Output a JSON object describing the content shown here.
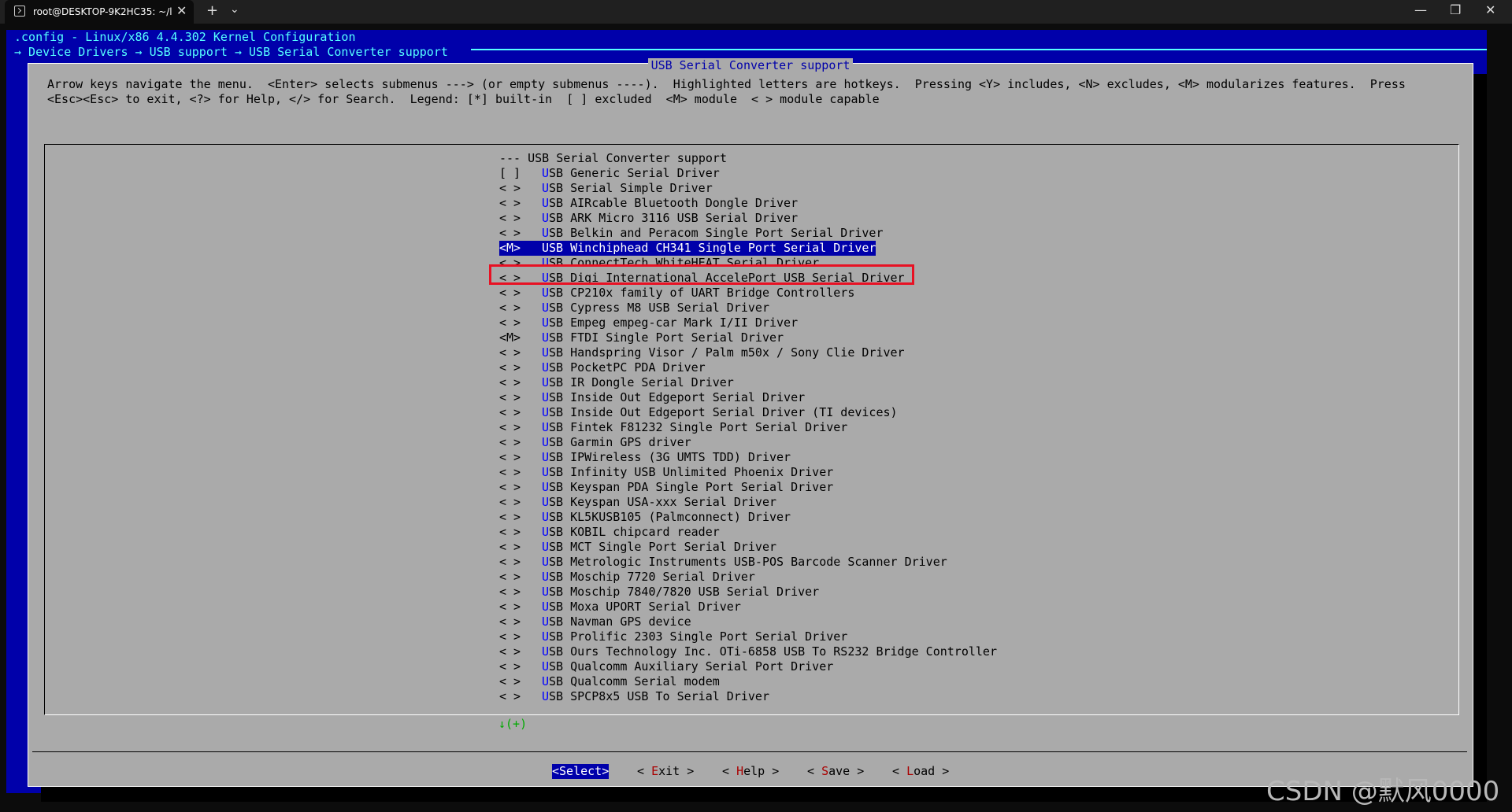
{
  "window": {
    "tab_title": "root@DESKTOP-9K2HC35: ~/l",
    "tab_close_glyph": "✕",
    "new_tab_glyph": "+",
    "dropdown_glyph": "⌄",
    "minimize_glyph": "—",
    "maximize_glyph": "❐",
    "close_glyph": "✕"
  },
  "header": {
    "line1": ".config - Linux/x86 4.4.302 Kernel Configuration",
    "breadcrumb": "→ Device Drivers → USB support → USB Serial Converter support"
  },
  "dialog": {
    "title": "USB Serial Converter support",
    "help_line1": "Arrow keys navigate the menu.  <Enter> selects submenus ---> (or empty submenus ----).  Highlighted letters are hotkeys.  Pressing <Y> includes, <N> excludes, <M> modularizes features.  Press",
    "help_line2": "<Esc><Esc> to exit, <?> for Help, </> for Search.  Legend: [*] built-in  [ ] excluded  <M> module  < > module capable"
  },
  "menu": {
    "heading": "--- USB Serial Converter support",
    "more_indicator": "↓(+)",
    "items": [
      {
        "mark": "[ ]",
        "hot": "U",
        "rest": "SB Generic Serial Driver"
      },
      {
        "mark": "< >",
        "hot": "U",
        "rest": "SB Serial Simple Driver"
      },
      {
        "mark": "< >",
        "hot": "U",
        "rest": "SB AIRcable Bluetooth Dongle Driver"
      },
      {
        "mark": "< >",
        "hot": "U",
        "rest": "SB ARK Micro 3116 USB Serial Driver"
      },
      {
        "mark": "< >",
        "hot": "U",
        "rest": "SB Belkin and Peracom Single Port Serial Driver"
      },
      {
        "mark": "<M>",
        "hot": "U",
        "rest": "SB Winchiphead CH341 Single Port Serial Driver",
        "selected": true
      },
      {
        "mark": "< >",
        "hot": "U",
        "rest": "SB ConnectTech WhiteHEAT Serial Driver"
      },
      {
        "mark": "< >",
        "hot": "U",
        "rest": "SB Digi International AccelePort USB Serial Driver"
      },
      {
        "mark": "< >",
        "hot": "U",
        "rest": "SB CP210x family of UART Bridge Controllers"
      },
      {
        "mark": "< >",
        "hot": "U",
        "rest": "SB Cypress M8 USB Serial Driver"
      },
      {
        "mark": "< >",
        "hot": "U",
        "rest": "SB Empeg empeg-car Mark I/II Driver"
      },
      {
        "mark": "<M>",
        "hot": "U",
        "rest": "SB FTDI Single Port Serial Driver"
      },
      {
        "mark": "< >",
        "hot": "U",
        "rest": "SB Handspring Visor / Palm m50x / Sony Clie Driver"
      },
      {
        "mark": "< >",
        "hot": "U",
        "rest": "SB PocketPC PDA Driver"
      },
      {
        "mark": "< >",
        "hot": "U",
        "rest": "SB IR Dongle Serial Driver"
      },
      {
        "mark": "< >",
        "hot": "U",
        "rest": "SB Inside Out Edgeport Serial Driver"
      },
      {
        "mark": "< >",
        "hot": "U",
        "rest": "SB Inside Out Edgeport Serial Driver (TI devices)"
      },
      {
        "mark": "< >",
        "hot": "U",
        "rest": "SB Fintek F81232 Single Port Serial Driver"
      },
      {
        "mark": "< >",
        "hot": "U",
        "rest": "SB Garmin GPS driver"
      },
      {
        "mark": "< >",
        "hot": "U",
        "rest": "SB IPWireless (3G UMTS TDD) Driver"
      },
      {
        "mark": "< >",
        "hot": "U",
        "rest": "SB Infinity USB Unlimited Phoenix Driver"
      },
      {
        "mark": "< >",
        "hot": "U",
        "rest": "SB Keyspan PDA Single Port Serial Driver"
      },
      {
        "mark": "< >",
        "hot": "U",
        "rest": "SB Keyspan USA-xxx Serial Driver"
      },
      {
        "mark": "< >",
        "hot": "U",
        "rest": "SB KL5KUSB105 (Palmconnect) Driver"
      },
      {
        "mark": "< >",
        "hot": "U",
        "rest": "SB KOBIL chipcard reader"
      },
      {
        "mark": "< >",
        "hot": "U",
        "rest": "SB MCT Single Port Serial Driver"
      },
      {
        "mark": "< >",
        "hot": "U",
        "rest": "SB Metrologic Instruments USB-POS Barcode Scanner Driver"
      },
      {
        "mark": "< >",
        "hot": "U",
        "rest": "SB Moschip 7720 Serial Driver"
      },
      {
        "mark": "< >",
        "hot": "U",
        "rest": "SB Moschip 7840/7820 USB Serial Driver"
      },
      {
        "mark": "< >",
        "hot": "U",
        "rest": "SB Moxa UPORT Serial Driver"
      },
      {
        "mark": "< >",
        "hot": "U",
        "rest": "SB Navman GPS device"
      },
      {
        "mark": "< >",
        "hot": "U",
        "rest": "SB Prolific 2303 Single Port Serial Driver"
      },
      {
        "mark": "< >",
        "hot": "U",
        "rest": "SB Ours Technology Inc. OTi-6858 USB To RS232 Bridge Controller"
      },
      {
        "mark": "< >",
        "hot": "U",
        "rest": "SB Qualcomm Auxiliary Serial Port Driver"
      },
      {
        "mark": "< >",
        "hot": "U",
        "rest": "SB Qualcomm Serial modem"
      },
      {
        "mark": "< >",
        "hot": "U",
        "rest": "SB SPCP8x5 USB To Serial Driver"
      }
    ]
  },
  "buttons": {
    "select": "<Select>",
    "exit_pre": "< ",
    "exit_hk": "E",
    "exit_rest": "xit",
    "exit_post": " >",
    "help_pre": "< ",
    "help_hk": "H",
    "help_rest": "elp",
    "help_post": " >",
    "save_pre": "< ",
    "save_hk": "S",
    "save_rest": "ave",
    "save_post": " >",
    "load_pre": "< ",
    "load_hk": "L",
    "load_rest": "oad",
    "load_post": " >"
  },
  "watermark": "CSDN @默风0000",
  "colors": {
    "terminal_bg": "#0000aa",
    "dialog_bg": "#aaaaaa",
    "hotkey": "#0000ff",
    "highlight_box": "#e81123"
  }
}
